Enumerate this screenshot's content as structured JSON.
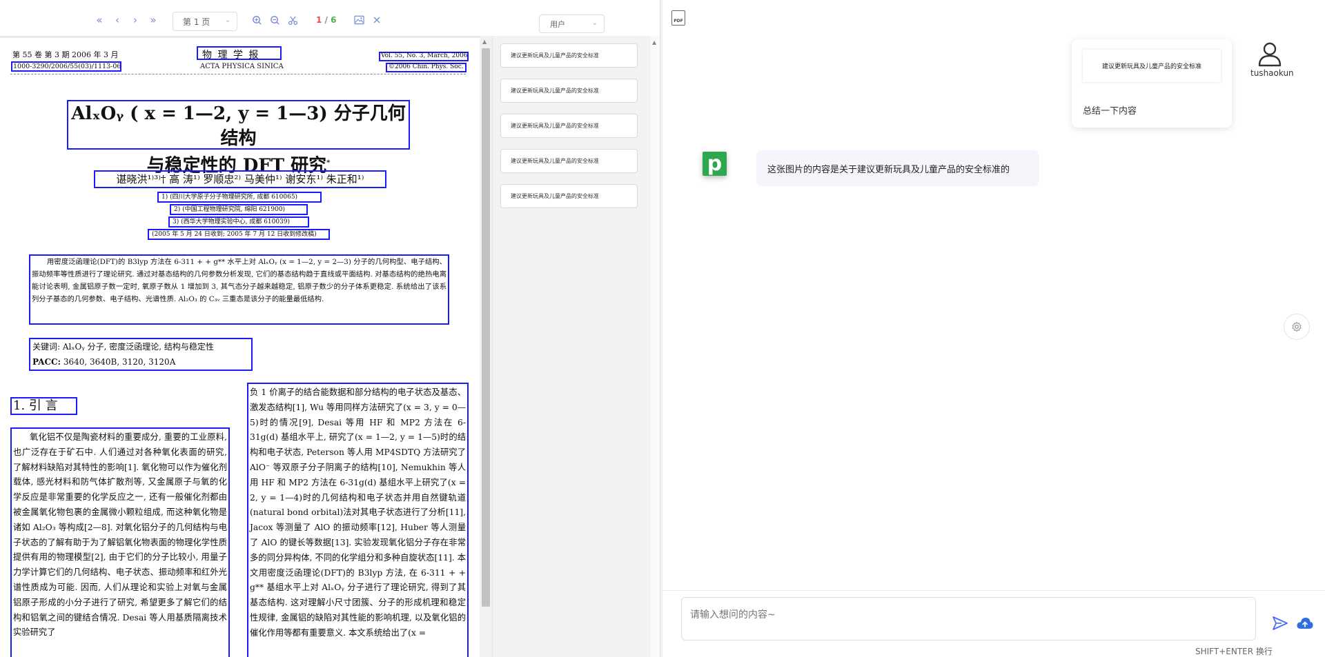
{
  "toolbar": {
    "first_page_glyph": "«",
    "prev_page_glyph": "‹",
    "next_page_glyph": "›",
    "last_page_glyph": "»",
    "page_select_value": "第 1 页",
    "current_page": "1",
    "page_separator": "/",
    "total_pages": "6",
    "role_select_value": "用户"
  },
  "paper": {
    "volume_line": "第 55 卷 第 3 期 2006 年 3 月",
    "issn_line": "1000-3290/2006/55(03)/1113-06",
    "journal_cn": "物 理 学 报",
    "journal_en": "ACTA PHYSICA SINICA",
    "vol_en": "Vol. 55, No. 3, March, 2006",
    "copyright": "©2006 Chin. Phys. Soc.",
    "title_line1": "AlₓOᵧ ( x = 1—2, y = 1—3) 分子几何结构",
    "title_line2": "与稳定性的 DFT 研究",
    "title_star": "*",
    "authors": "谌晓洪¹⁾³⁾†   高  涛¹⁾   罗顺忠²⁾   马美仲¹⁾   谢安东¹⁾   朱正和¹⁾",
    "aff1": "1) (四川大学原子分子物理研究所, 成都   610065)",
    "aff2": "2) (中国工程物理研究院, 绵阳   621900)",
    "aff3": "3) (西华大学物理实验中心, 成都   610039)",
    "received": "(2005 年 5 月 24 日收到; 2005 年 7 月 12 日收到修改稿)",
    "abstract": "用密度泛函理论(DFT)的 B3lyp 方法在 6-311 + + g** 水平上对 AlₓOᵧ (x = 1—2, y = 2—3) 分子的几何构型、电子结构、振动频率等性质进行了理论研究. 通过对基态结构的几何参数分析发现, 它们的基态结构趋于直线或平面结构. 对基态结构的绝热电离能讨论表明, 金属铝原子数一定时, 氧原子数从 1 增加到 3, 其气态分子越来越稳定, 铝原子数少的分子体系更稳定. 系统给出了该系列分子基态的几何参数、电子结构、光谱性质. Al₂O₃ 的 C₃ᵥ 三重态是该分子的能量最低结构.",
    "keywords": "关键词: AlₓOᵧ 分子, 密度泛函理论, 结构与稳定性",
    "pacc_label": "PACC:",
    "pacc": "3640, 3640B, 3120, 3120A",
    "section_title": "1. 引    言",
    "col_left": "氧化铝不仅是陶瓷材料的重要成分, 重要的工业原料, 也广泛存在于矿石中. 人们通过对各种氧化表面的研究, 了解材料缺陷对其特性的影响[1]. 氧化物可以作为催化剂载体, 感光材料和防气体扩散剂等, 又金属原子与氧的化学反应是非常重要的化学反应之一, 还有一般催化剂都由被金属氧化物包裹的金属微小颗粒组成, 而这种氧化物是诸如 Al₂O₃ 等构成[2—8]. 对氧化铝分子的几何结构与电子状态的了解有助于为了解铝氧化物表面的物理化学性质提供有用的物理模型[2], 由于它们的分子比较小, 用量子力学计算它们的几何结构、电子状态、振动频率和红外光谱性质成为可能. 因而, 人们从理论和实验上对氧与金属铝原子形成的小分子进行了研究, 希望更多了解它们的结构和铝氧之间的键结合情况. Desai 等人用基质隔离技术实验研究了",
    "col_right": "负 1 价离子的结合能数据和部分结构的电子状态及基态、激发态结构[1], Wu 等用同样方法研究了(x = 3, y = 0—5)时的情况[9], Desai 等用 HF 和 MP2 方法在 6-31g(d) 基组水平上, 研究了(x = 1—2, y = 1—5)时的结构和电子状态, Peterson 等人用 MP4SDTQ 方法研究了 AlO⁻ 等双原子分子阴离子的结构[10], Nemukhin 等人用 HF 和 MP2 方法在 6-31g(d) 基组水平上研究了(x = 2, y = 1—4)时的几何结构和电子状态并用自然键轨道(natural bond orbital)法对其电子状态进行了分析[11], Jacox 等测量了 AlO 的振动频率[12], Huber 等人测量了 AlO 的键长等数据[13]. 实验发现氧化铝分子存在非常多的同分异构体, 不同的化学组分和多种自旋状态[11]. 本文用密度泛函理论(DFT)的 B3lyp 方法, 在 6-311 + + g** 基组水平上对 AlₓOᵧ 分子进行了理论研究, 得到了其基态结构. 这对理解小尺寸团簇、分子的形成机理和稳定性规律, 金属铝的缺陷对其性能的影响机理, 以及氧化铝的催化作用等都有重要意义. 本文系统给出了(x ="
  },
  "side_panel": {
    "items": [
      "建议更新玩具及儿童产品的安全标准",
      "建议更新玩具及儿童产品的安全标准",
      "建议更新玩具及儿童产品的安全标准",
      "建议更新玩具及儿童产品的安全标准",
      "建议更新玩具及儿童产品的安全标准"
    ]
  },
  "chat": {
    "pdf_label": "PDF",
    "user_name": "tushaokun",
    "user_preview_text": "建议更新玩具及儿童产品的安全标准",
    "user_message": "总结一下内容",
    "bot_avatar_letter": "p",
    "bot_message": "这张图片的内容是关于建议更新玩具及儿童产品的安全标准的",
    "input_placeholder": "请输入想问的内容~",
    "hint": "SHIFT+ENTER 换行",
    "colors": {
      "accent": "#1a1aff",
      "bot_green": "#2ea84f",
      "send_blue": "#4a6cf7",
      "upload_blue": "#2f6fe0"
    },
    "icons": [
      "pdf-icon",
      "user-icon",
      "settings-icon",
      "send-icon",
      "cloud-upload-icon"
    ]
  }
}
